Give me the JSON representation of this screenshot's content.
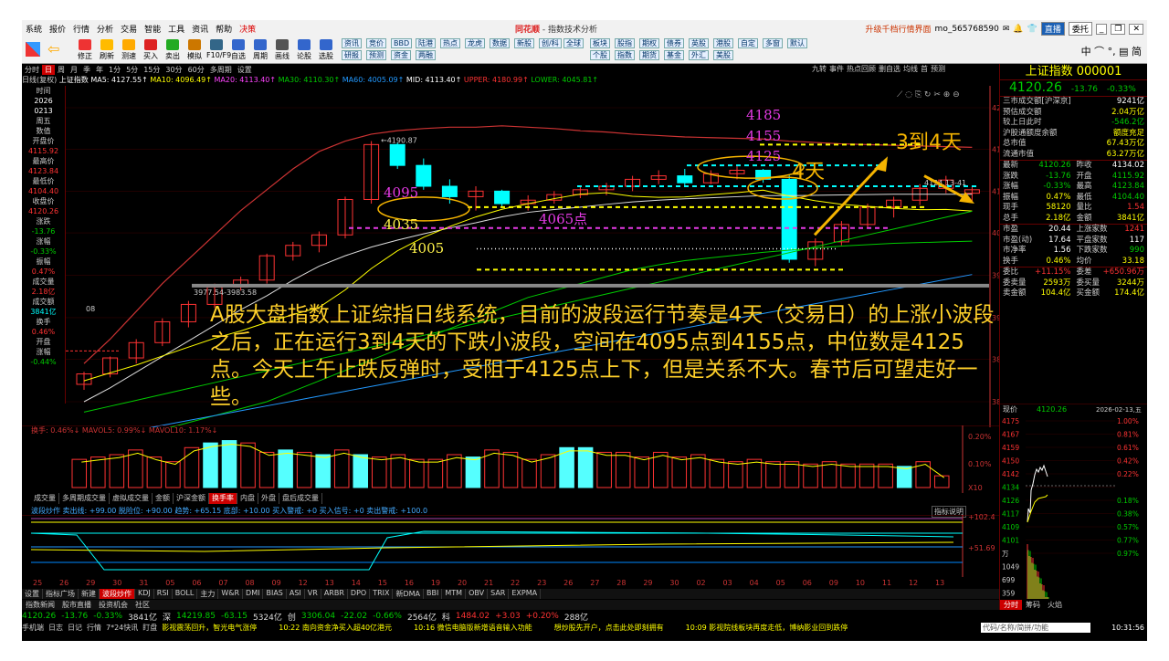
{
  "menu": {
    "items": [
      "系统",
      "报价",
      "行情",
      "分析",
      "交易",
      "智能",
      "工具",
      "资讯",
      "帮助"
    ],
    "highlight": "决策",
    "title_brand": "同花顺",
    "title_rest": " - 指数技术分析",
    "upgrade": "升级千档行情界面",
    "user": "mo_565768590",
    "btn_zhibo": "直播",
    "btn_weituo": "委托"
  },
  "toolbar": {
    "icons": [
      "修正",
      "刷新",
      "测速",
      "买入",
      "卖出",
      "模拟",
      "F10/F9",
      "自选",
      "周期",
      "画线",
      "论股",
      "选股"
    ],
    "btns_row1": [
      "资讯",
      "竞价",
      "BBD",
      "陆港",
      "热点",
      "龙虎",
      "数据",
      "新股",
      "创/科",
      "全球"
    ],
    "btns_row2": [
      "研报",
      "预测",
      "资金",
      "两融"
    ],
    "btns_right1": [
      "板块",
      "股指",
      "期权",
      "债券",
      "英股",
      "港股",
      "自定",
      "多窗",
      "默认"
    ],
    "btns_right2": [
      "个股",
      "指数",
      "期货",
      "基金",
      "外汇",
      "美股"
    ],
    "right_chars": "中 ⌒ °, ▤ 简"
  },
  "periodbar": {
    "items": [
      "分时",
      "日",
      "周",
      "月",
      "季",
      "年",
      "1分",
      "5分",
      "15分",
      "30分",
      "60分",
      "多周期",
      "设置"
    ],
    "active": "日",
    "right": [
      "九转",
      "事件",
      "热点回顾",
      "删自选",
      "均线",
      "首",
      "预测"
    ]
  },
  "maline": {
    "label": "日线(复权)",
    "name": "上证指数",
    "ma5": "MA5: 4127.55↑",
    "ma10": "MA10: 4096.49↑",
    "ma20": "MA20: 4113.40↑",
    "ma30": "MA30: 4110.30↑",
    "ma60": "MA60: 4005.09↑",
    "mid": "MID: 4113.40↑",
    "upper": "UPPER: 4180.99↑",
    "lower": "LOWER: 4045.81↑"
  },
  "leftpanel": {
    "rows": [
      {
        "k": "时间",
        "v": "2026"
      },
      {
        "k": "",
        "v": "0213"
      },
      {
        "k": "周五",
        "v": ""
      },
      {
        "k": "数值",
        "v": ""
      },
      {
        "k": "开盘价",
        "v": "4115.92"
      },
      {
        "k": "最高价",
        "v": "4123.84"
      },
      {
        "k": "最低价",
        "v": "4104.40"
      },
      {
        "k": "收盘价",
        "v": "4120.26"
      },
      {
        "k": "涨跌",
        "v": "-13.76"
      },
      {
        "k": "涨幅",
        "v": "-0.33%"
      },
      {
        "k": "振幅",
        "v": "0.47%"
      },
      {
        "k": "成交量",
        "v": "2.18亿"
      },
      {
        "k": "成交额",
        "v": "3841亿"
      },
      {
        "k": "换手",
        "v": "0.46%"
      },
      {
        "k": "开盘",
        "v": ""
      },
      {
        "k": "涨幅",
        "v": "-0.44%"
      }
    ]
  },
  "chart_axis": {
    "yticks": [
      "4238",
      "4178",
      "4118",
      "4058",
      "3997",
      "3936",
      "3876",
      "3815"
    ],
    "hi_label": "4190.87",
    "lo_label": "3977.54-3983.58",
    "last_label": "4124.13-41",
    "left_cut": "08"
  },
  "annotations": {
    "n4185": "4185",
    "n4155": "4155",
    "n4125": "4125",
    "n4095": "4095",
    "n4065": "4065点",
    "n4035": "4035",
    "n4005": "4005",
    "days4": "4天",
    "days34": "3到4天"
  },
  "overlay_text": "A股大盘指数上证综指日线系统，目前的波段运行节奏是4天（交易日）的上涨小波段之后，正在运行3到4天的下跌小波段，空间在4095点到4155点，中位数是4125点。今天上午止跌反弹时，受阻于4125点上下，但是关系不大。春节后可望走好一些。",
  "volume": {
    "label": "换手: 0.46%↓  MAVOL5: 0.99%↓  MAVOL10: 1.17%↓",
    "y1": "0.20%",
    "y2": "0.10%",
    "unit": "X10",
    "bars": [
      0.12,
      0.13,
      0.14,
      0.16,
      0.13,
      0.11,
      0.17,
      0.19,
      0.2,
      0.19,
      0.15,
      0.16,
      0.15,
      0.14,
      0.16,
      0.14,
      0.13,
      0.14,
      0.12,
      0.12,
      0.14,
      0.13,
      0.16,
      0.15,
      0.12,
      0.14,
      0.17,
      0.17,
      0.15,
      0.15,
      0.13,
      0.15,
      0.13,
      0.14,
      0.12,
      0.11,
      0.12,
      0.11,
      0.11,
      0.1,
      0.11,
      0.1,
      0.1,
      0.1,
      0.09,
      0.11,
      0.05
    ],
    "cyan": [
      false,
      false,
      false,
      false,
      false,
      false,
      false,
      true,
      true,
      false,
      false,
      true,
      false,
      true,
      false,
      true,
      false,
      false,
      false,
      false,
      false,
      true,
      false,
      false,
      false,
      false,
      true,
      true,
      false,
      false,
      false,
      false,
      false,
      false,
      false,
      false,
      false,
      false,
      false,
      false,
      false,
      false,
      false,
      false,
      true,
      false
    ]
  },
  "subtabs": {
    "items": [
      "成交量",
      "多周期成交量",
      "虚拟成交量",
      "金额",
      "沪深金额",
      "换手率",
      "内盘",
      "外盘",
      "盘后成交量"
    ],
    "active": "换手率"
  },
  "indicator": {
    "line": "波段炒作  卖出线: +99.00 脱险位: +90.00  趋势: +65.15  底部: +10.00  买入警戒: +0  买入信号: +0  卖出警戒: +100.0",
    "explain": "指标说明",
    "y1": "+102.4",
    "y2": "+51.69"
  },
  "dates": [
    "25",
    "26",
    "29",
    "30",
    "31",
    "05",
    "06",
    "07",
    "08",
    "09",
    "12",
    "13",
    "14",
    "15",
    "16",
    "19",
    "20",
    "21",
    "22",
    "23",
    "26",
    "27",
    "28",
    "29",
    "30",
    "02",
    "03",
    "04",
    "05",
    "06",
    "09",
    "10",
    "11",
    "12",
    "13"
  ],
  "bottomtabs": {
    "items": [
      "设置",
      "指标广场",
      "新建",
      "波段炒作",
      "KDJ",
      "RSI",
      "BOLL",
      "主力",
      "W&R",
      "DMI",
      "BIAS",
      "ASI",
      "VR",
      "ARBR",
      "DPO",
      "TRIX",
      "新DMA",
      "BBI",
      "MTM",
      "OBV",
      "SAR",
      "EXPMA"
    ],
    "active": "波段炒作",
    "row2": [
      "指数新闻",
      "股市直播",
      "投资机会",
      "社区"
    ]
  },
  "ticker": [
    {
      "t": "4120.26",
      "c": "g"
    },
    {
      "t": "-13.76",
      "c": "g"
    },
    {
      "t": "-0.33%",
      "c": "g"
    },
    {
      "t": "3841亿",
      "c": "w"
    },
    {
      "t": "深",
      "c": "w"
    },
    {
      "t": "14219.85",
      "c": "g"
    },
    {
      "t": "-63.15",
      "c": "g"
    },
    {
      "t": "5324亿",
      "c": "w"
    },
    {
      "t": "创",
      "c": "w"
    },
    {
      "t": "3306.04",
      "c": "g"
    },
    {
      "t": "-22.02",
      "c": "g"
    },
    {
      "t": "-0.66%",
      "c": "g"
    },
    {
      "t": "2564亿",
      "c": "w"
    },
    {
      "t": "科",
      "c": "w"
    },
    {
      "t": "1484.02",
      "c": "r"
    },
    {
      "t": "+3.03",
      "c": "r"
    },
    {
      "t": "+0.20%",
      "c": "r"
    },
    {
      "t": "288亿",
      "c": "w"
    }
  ],
  "news": {
    "left": [
      "手机端",
      "日志",
      "日记",
      "行情",
      "7*24快讯",
      "盯盘"
    ],
    "items": [
      "影视震荡回升，智光电气涨停",
      "10:22 南向资金净买入超40亿港元",
      "10:16 微信电脑版新增语音输入功能",
      "想炒股先开户，点击此处即刻拥有",
      "10:09 影视院线板块再度走低，博纳影业回到跌停"
    ],
    "code_placeholder": "代码/名称/简拼/功能",
    "clock": "10:31:56"
  },
  "right": {
    "title": "上证指数 000001",
    "price": "4120.26",
    "chg": "-13.76",
    "pct": "-0.33%",
    "block1": [
      {
        "k": "三市成交额[沪深京]",
        "v": "9241亿",
        "c": "w"
      },
      {
        "k": "预估成交额",
        "v": "2.04万亿",
        "c": "y"
      },
      {
        "k": "较上日此时",
        "v": "-546.2亿",
        "c": "g"
      },
      {
        "k": "沪股通额度余额",
        "v": "额度充足",
        "c": "y"
      },
      {
        "k": "总市值",
        "v": "67.43万亿",
        "c": "y"
      },
      {
        "k": "流通市值",
        "v": "63.27万亿",
        "c": "y"
      }
    ],
    "block2": [
      [
        {
          "k": "最新",
          "v": "4120.26",
          "c": "g"
        },
        {
          "k": "昨收",
          "v": "4134.02",
          "c": "w"
        }
      ],
      [
        {
          "k": "涨跌",
          "v": "-13.76",
          "c": "g"
        },
        {
          "k": "开盘",
          "v": "4115.92",
          "c": "g"
        }
      ],
      [
        {
          "k": "涨幅",
          "v": "-0.33%",
          "c": "g"
        },
        {
          "k": "最高",
          "v": "4123.84",
          "c": "g"
        }
      ],
      [
        {
          "k": "振幅",
          "v": "0.47%",
          "c": "y"
        },
        {
          "k": "最低",
          "v": "4104.40",
          "c": "g"
        }
      ],
      [
        {
          "k": "现手",
          "v": "58120",
          "c": "y"
        },
        {
          "k": "量比",
          "v": "1.54",
          "c": "r"
        }
      ],
      [
        {
          "k": "总手",
          "v": "2.18亿",
          "c": "y"
        },
        {
          "k": "金额",
          "v": "3841亿",
          "c": "y"
        }
      ]
    ],
    "block3": [
      [
        {
          "k": "市盈",
          "v": "20.44",
          "c": "w"
        },
        {
          "k": "上涨家数",
          "v": "1241",
          "c": "r"
        }
      ],
      [
        {
          "k": "市盈(动)",
          "v": "17.64",
          "c": "w"
        },
        {
          "k": "平盘家数",
          "v": "117",
          "c": "w"
        }
      ],
      [
        {
          "k": "市净率",
          "v": "1.56",
          "c": "w"
        },
        {
          "k": "下跌家数",
          "v": "990",
          "c": "g"
        }
      ],
      [
        {
          "k": "换手",
          "v": "0.46%",
          "c": "y"
        },
        {
          "k": "均价",
          "v": "33.18",
          "c": "y"
        }
      ]
    ],
    "block4": [
      [
        {
          "k": "委比",
          "v": "+11.15%",
          "c": "r"
        },
        {
          "k": "委差",
          "v": "+650.96万",
          "c": "r"
        }
      ],
      [
        {
          "k": "委卖量",
          "v": "2593万",
          "c": "y"
        },
        {
          "k": "委买量",
          "v": "3244万",
          "c": "y"
        }
      ],
      [
        {
          "k": "卖金额",
          "v": "104.4亿",
          "c": "y"
        },
        {
          "k": "买金额",
          "v": "174.4亿",
          "c": "y"
        }
      ]
    ],
    "mini_head": {
      "k": "现价",
      "v": "4120.26",
      "d": "2026-02-13,五"
    },
    "mini_left": [
      "4175",
      "4167",
      "4159",
      "4150",
      "4142",
      "4134",
      "4126",
      "4117",
      "4109",
      "4101",
      "万",
      "1049",
      "699",
      "359",
      "万"
    ],
    "mini_right": [
      "1.00%",
      "0.81%",
      "0.61%",
      "0.42%",
      "0.22%",
      "",
      "0.18%",
      "0.38%",
      "0.57%",
      "0.77%",
      "0.97%"
    ],
    "tabs": [
      "分时",
      "筹码",
      "火焰"
    ]
  },
  "colors": {
    "up": "#ff3333",
    "down": "#00cc00",
    "cyan": "#00ffff",
    "yellow": "#ffff00",
    "magenta": "#ff44ff",
    "anno_orange": "#f5b400"
  }
}
